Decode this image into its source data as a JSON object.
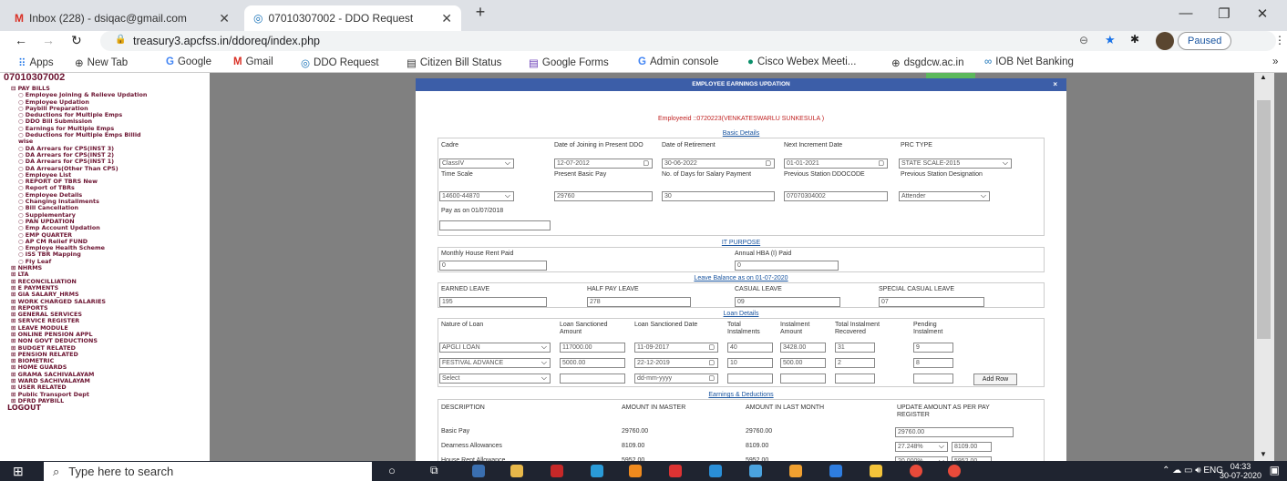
{
  "tabs": [
    {
      "label": "Inbox (228) - dsiqac@gmail.com"
    },
    {
      "label": "07010307002 - DDO Request"
    }
  ],
  "address": {
    "url": "treasury3.apcfss.in/ddoreq/index.php",
    "profile": "Paused"
  },
  "bookmarks": [
    "Apps",
    "New Tab",
    "Google",
    "Gmail",
    "DDO Request",
    "Citizen Bill Status",
    "Google Forms",
    "Admin console",
    "Cisco Webex Meeti...",
    "dsgdcw.ac.in",
    "IOB Net Banking"
  ],
  "sidebar": {
    "title": "07010307002",
    "items": [
      {
        "label": "⊟ PAY BILLS",
        "sub": false
      },
      {
        "label": "○ Employee Joining & Relieve Updation",
        "sub": true
      },
      {
        "label": "○ Employee Updation",
        "sub": true
      },
      {
        "label": "○ Paybill Preparation",
        "sub": true
      },
      {
        "label": "○ Deductions for Multiple Emps",
        "sub": true
      },
      {
        "label": "○ DDO Bill Submission",
        "sub": true
      },
      {
        "label": "○ Earnings for Multiple Emps",
        "sub": true
      },
      {
        "label": "○ Deductions for Multiple Emps Billid",
        "sub": true
      },
      {
        "label": "   wise",
        "sub": true
      },
      {
        "label": "○ DA Arrears for CPS(INST 3)",
        "sub": true
      },
      {
        "label": "○ DA Arrears for CPS(INST 2)",
        "sub": true
      },
      {
        "label": "○ DA Arrears for CPS(INST 1)",
        "sub": true
      },
      {
        "label": "○ DA Arrears(Other Than CPS)",
        "sub": true
      },
      {
        "label": "○ Employee List",
        "sub": true
      },
      {
        "label": "○ REPORT OF TBRS New",
        "sub": true
      },
      {
        "label": "○ Report of TBRs",
        "sub": true
      },
      {
        "label": "○ Employee Details",
        "sub": true
      },
      {
        "label": "○ Changing Installments",
        "sub": true
      },
      {
        "label": "○ Bill Cancellation",
        "sub": true
      },
      {
        "label": "○ Supplementary",
        "sub": true
      },
      {
        "label": "○ PAN UPDATION",
        "sub": true
      },
      {
        "label": "○ Emp Account Updation",
        "sub": true
      },
      {
        "label": "○ EMP QUARTER",
        "sub": true
      },
      {
        "label": "○ AP CM Relief FUND",
        "sub": true
      },
      {
        "label": "○ Employe Health Scheme",
        "sub": true
      },
      {
        "label": "○ ISS TBR Mapping",
        "sub": true
      },
      {
        "label": "○ Fly Leaf",
        "sub": true
      },
      {
        "label": "⊞ NHRMS",
        "sub": false
      },
      {
        "label": "⊞ LTA",
        "sub": false
      },
      {
        "label": "⊞ RECONCILLIATION",
        "sub": false
      },
      {
        "label": "⊞ E PAYMENTS",
        "sub": false
      },
      {
        "label": "⊞ GIA SALARY_HRMS",
        "sub": false
      },
      {
        "label": "⊞ WORK CHARGED SALARIES",
        "sub": false
      },
      {
        "label": "⊞ REPORTS",
        "sub": false
      },
      {
        "label": "⊞ GENERAL SERVICES",
        "sub": false
      },
      {
        "label": "⊞ SERVICE REGISTER",
        "sub": false
      },
      {
        "label": "⊞ LEAVE MODULE",
        "sub": false
      },
      {
        "label": "⊞ ONLINE PENSION APPL",
        "sub": false
      },
      {
        "label": "⊞ NON GOVT DEDUCTIONS",
        "sub": false
      },
      {
        "label": "⊞ BUDGET RELATED",
        "sub": false
      },
      {
        "label": "⊞ PENSION RELATED",
        "sub": false
      },
      {
        "label": "⊞ BIOMETRIC",
        "sub": false
      },
      {
        "label": "⊞ HOME GUARDS",
        "sub": false
      },
      {
        "label": "⊞ GRAMA SACHIVALAYAM",
        "sub": false
      },
      {
        "label": "⊞ WARD SACHIVALAYAM",
        "sub": false
      },
      {
        "label": "⊞ USER RELATED",
        "sub": false
      },
      {
        "label": "⊞ Public Transport Dept",
        "sub": false
      },
      {
        "label": "⊞ DFRD PAYBILL",
        "sub": false
      }
    ],
    "logout": "LOGOUT"
  },
  "modal": {
    "title": "EMPLOYEE EARNINGS UPDATION",
    "close": "×",
    "employee": "Employeeid ::0720223(VENKATESWARLU SUNKESULA )",
    "basic": {
      "heading": "Basic Details",
      "l_cadre": "Cadre",
      "v_cadre": "ClassIV",
      "l_doj": "Date of Joining in Present DDO",
      "v_doj": "12-07-2012",
      "l_dor": "Date of Retirement",
      "v_dor": "30-06-2022",
      "l_nid": "Next Increment Date",
      "v_nid": "01-01-2021",
      "l_prc": "PRC TYPE",
      "v_prc": "STATE SCALE-2015",
      "l_ts": "Time Scale",
      "v_ts": "14600-44870",
      "l_pbp": "Present Basic Pay",
      "v_pbp": "29760",
      "l_nod": "No. of Days for Salary Payment",
      "v_nod": "30",
      "l_psd": "Previous Station DDOCODE",
      "v_psd": "07070304002",
      "l_psdes": "Previous Station Designation",
      "v_psdes": "Attender",
      "l_pay": "Pay as on 01/07/2018",
      "v_pay": ""
    },
    "it": {
      "heading": "IT PURPOSE",
      "l_hr": "Monthly House Rent Paid",
      "v_hr": "0",
      "l_hba": "Annual HBA (I) Paid",
      "v_hba": "0"
    },
    "leave": {
      "heading": "Leave Balance as on 01-07-2020",
      "l_el": "EARNED LEAVE",
      "v_el": "195",
      "l_hpl": "HALF PAY LEAVE",
      "v_hpl": "278",
      "l_cl": "CASUAL LEAVE",
      "v_cl": "09",
      "l_scl": "SPECIAL CASUAL LEAVE",
      "v_scl": "07"
    },
    "loan": {
      "heading": "Loan Details",
      "h_nature": "Nature of Loan",
      "h_amt": "Loan Sanctioned Amount",
      "h_date": "Loan Sanctioned Date",
      "h_total": "Total Instalments",
      "h_inst": "Instalment Amount",
      "h_rec": "Total Instalment Recovered",
      "h_pend": "Pending Instalment",
      "rows": [
        {
          "nature": "APGLI LOAN",
          "amount": "117000.00",
          "date": "11-09-2017",
          "total": "40",
          "inst": "3428.00",
          "rec": "31",
          "pend": "9"
        },
        {
          "nature": "FESTIVAL ADVANCE",
          "amount": "5000.00",
          "date": "22-12-2019",
          "total": "10",
          "inst": "500.00",
          "rec": "2",
          "pend": "8"
        },
        {
          "nature": "Select",
          "amount": "",
          "date": "dd-mm-yyyy",
          "total": "",
          "inst": "",
          "rec": "",
          "pend": ""
        }
      ],
      "add_row": "Add Row"
    },
    "earn": {
      "heading": "Earnings & Deductions",
      "h_desc": "DESCRIPTION",
      "h_master": "AMOUNT IN MASTER",
      "h_last": "AMOUNT IN LAST MONTH",
      "h_update": "UPDATE AMOUNT AS PER PAY REGISTER",
      "rows": [
        {
          "desc": "Basic Pay",
          "master": "29760.00",
          "last": "29760.00",
          "pct": "",
          "update": "29760.00"
        },
        {
          "desc": "Dearness Allowances",
          "master": "8109.00",
          "last": "8109.00",
          "pct": "27.248%",
          "update": "8109.00"
        },
        {
          "desc": "House Rent Allowance",
          "master": "5952.00",
          "last": "5952.00",
          "pct": "20.000%",
          "update": "5952.00"
        }
      ]
    }
  },
  "taskbar": {
    "search_placeholder": "Type here to search",
    "lang": "ENG",
    "time": "04:33",
    "date": "30-07-2020"
  }
}
